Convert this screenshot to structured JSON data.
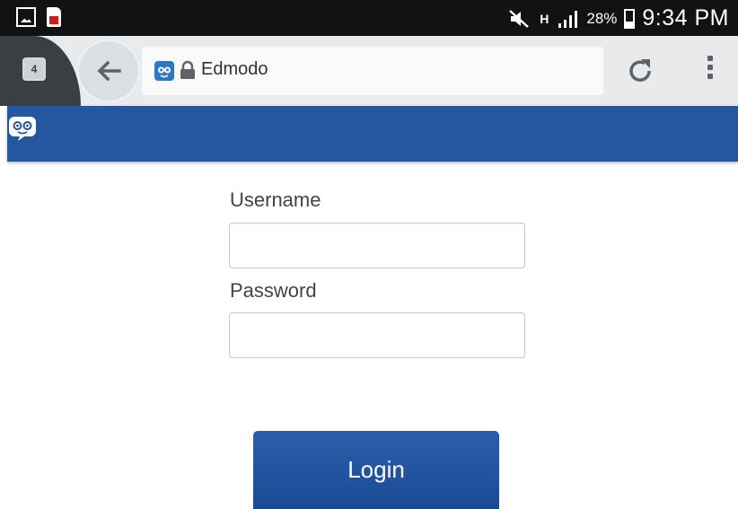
{
  "status_bar": {
    "network_label": "H",
    "battery_text": "28%",
    "battery_level": 0.28,
    "time": "9:34 PM",
    "icons": [
      "image-icon",
      "sd-card-icon",
      "mute-icon",
      "signal-icon",
      "battery-icon"
    ]
  },
  "browser": {
    "tab_count": "4",
    "url_text": "Edmodo",
    "icons": [
      "back-arrow-icon",
      "edmodo-favicon",
      "lock-icon",
      "reload-icon",
      "menu-icon"
    ]
  },
  "app_header": {
    "logo": "edmodo-logo-icon",
    "color": "#2556a0"
  },
  "login_form": {
    "username_label": "Username",
    "username_value": "",
    "password_label": "Password",
    "password_value": "",
    "login_button_label": "Login"
  }
}
